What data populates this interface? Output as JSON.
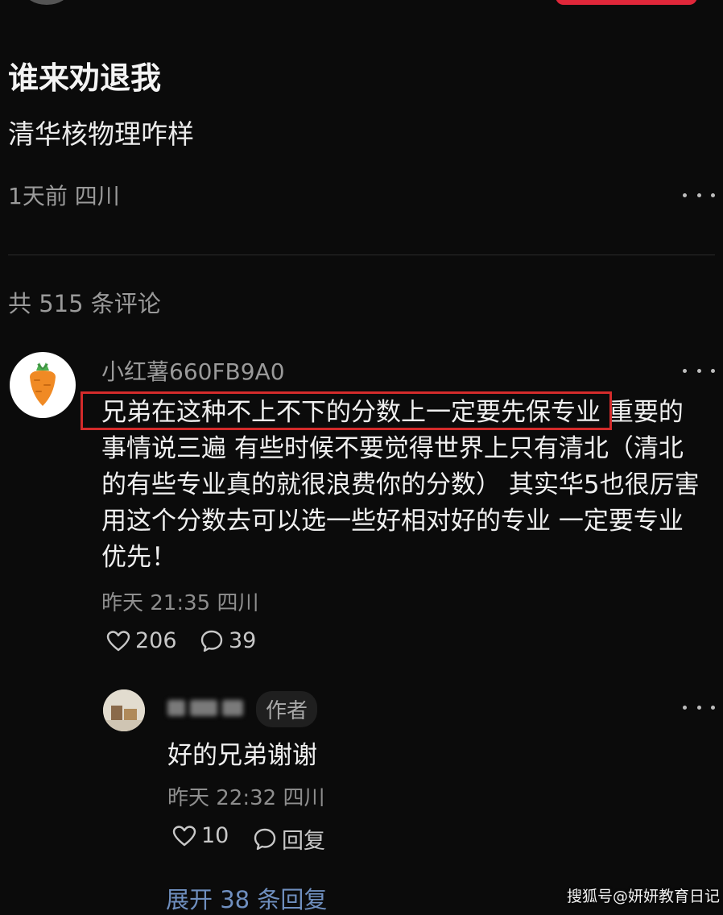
{
  "post": {
    "title": "谁来劝退我",
    "body": "清华核物理咋样",
    "meta": "1天前 四川"
  },
  "comments_header": {
    "count_text": "共 515 条评论"
  },
  "comment": {
    "username": "小红薯660FB9A0",
    "text_lines": [
      "兄弟在这种不上不下的分数上一定要先保专业 重要的",
      "事情说三遍 有些时候不要觉得世界上只有清北（清北",
      "的有些专业真的就很浪费你的分数） 其实华5也很厉害",
      "用这个分数去可以选一些好相对好的专业 一定要专业",
      "优先！"
    ],
    "time": "昨天 21:35 四川",
    "likes": "206",
    "replies": "39"
  },
  "reply": {
    "author_tag": "作者",
    "text": "好的兄弟谢谢",
    "time": "昨天 22:32 四川",
    "likes": "10",
    "reply_label": "回复"
  },
  "expand_label": "展开 38 条回复",
  "watermark": "搜狐号@妍妍教育日记",
  "colors": {
    "background": "#0b0b0b",
    "highlight_box": "#d42b2b",
    "expand_link": "#6f8fbf"
  },
  "icons": [
    "more-icon",
    "carrot-icon",
    "heart-icon",
    "comment-icon"
  ]
}
